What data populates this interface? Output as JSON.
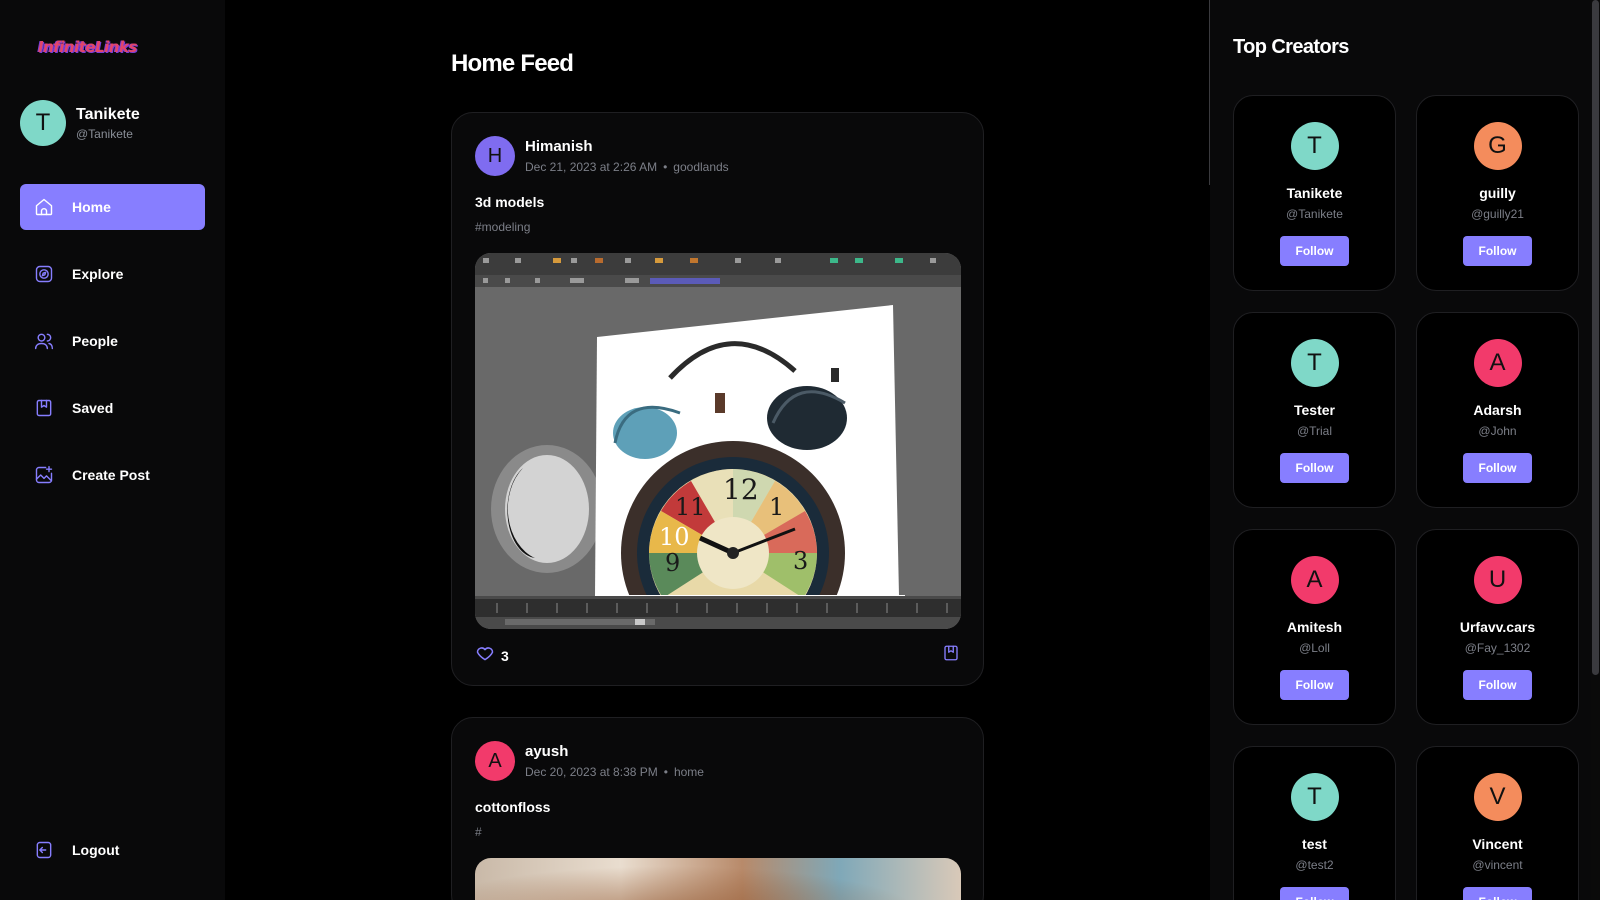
{
  "app": {
    "logo_text": "InfiniteLinks"
  },
  "user": {
    "initial": "T",
    "name": "Tanikete",
    "handle": "@Tanikete",
    "avatar_color": "#7fd8c8"
  },
  "nav": {
    "items": [
      {
        "label": "Home",
        "icon": "home-icon",
        "active": true
      },
      {
        "label": "Explore",
        "icon": "compass-icon",
        "active": false
      },
      {
        "label": "People",
        "icon": "people-icon",
        "active": false
      },
      {
        "label": "Saved",
        "icon": "bookmark-icon",
        "active": false
      },
      {
        "label": "Create Post",
        "icon": "image-plus-icon",
        "active": false
      }
    ],
    "logout_label": "Logout"
  },
  "feed": {
    "title": "Home Feed",
    "posts": [
      {
        "author": "Himanish",
        "initial": "H",
        "avatar_color": "#7f6cf0",
        "date": "Dec 21, 2023 at 2:26 AM",
        "location": "goodlands",
        "caption": "3d models",
        "tags": "#modeling",
        "likes": "3",
        "image": "alarm-clock-3d-modeling-screenshot"
      },
      {
        "author": "ayush",
        "initial": "A",
        "avatar_color": "#f23a6b",
        "date": "Dec 20, 2023 at 8:38 PM",
        "location": "home",
        "caption": "cottonfloss",
        "tags": "#",
        "image": "blurred-photo"
      }
    ]
  },
  "top_creators": {
    "title": "Top Creators",
    "follow_label": "Follow",
    "items": [
      {
        "initial": "T",
        "name": "Tanikete",
        "handle": "@Tanikete",
        "color": "#7fd8c8"
      },
      {
        "initial": "G",
        "name": "guilly",
        "handle": "@guilly21",
        "color": "#f48c5c"
      },
      {
        "initial": "T",
        "name": "Tester",
        "handle": "@Trial",
        "color": "#7fd8c8"
      },
      {
        "initial": "A",
        "name": "Adarsh",
        "handle": "@John",
        "color": "#f23a6b"
      },
      {
        "initial": "A",
        "name": "Amitesh",
        "handle": "@Loll",
        "color": "#f23a6b"
      },
      {
        "initial": "U",
        "name": "Urfavv.cars",
        "handle": "@Fay_1302",
        "color": "#f23a6b"
      },
      {
        "initial": "T",
        "name": "test",
        "handle": "@test2",
        "color": "#7fd8c8"
      },
      {
        "initial": "V",
        "name": "Vincent",
        "handle": "@vincent",
        "color": "#f48c5c"
      }
    ]
  },
  "colors": {
    "accent": "#877eff",
    "background": "#000000",
    "card": "#09090a",
    "muted": "#7c7f88"
  }
}
